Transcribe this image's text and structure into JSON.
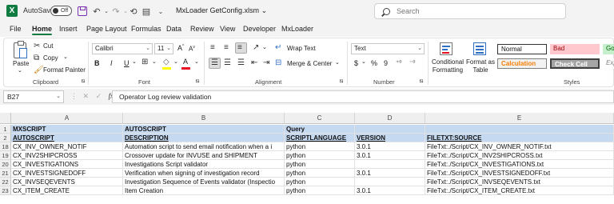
{
  "titlebar": {
    "app_icon": "X",
    "autosave_label": "AutoSave",
    "toggle_state": "Off",
    "file_title": "MxLoader GetConfig.xlsm",
    "file_title_chevron": "⌄",
    "search_placeholder": "Search"
  },
  "tabs": [
    "File",
    "Home",
    "Insert",
    "Page Layout",
    "Formulas",
    "Data",
    "Review",
    "View",
    "Developer",
    "MxLoader"
  ],
  "active_tab": "Home",
  "ribbon": {
    "clipboard": {
      "paste": "Paste",
      "cut": "Cut",
      "copy": "Copy",
      "format_painter": "Format Painter",
      "label": "Clipboard"
    },
    "font": {
      "name": "Calibri",
      "size": "11",
      "grow": "A",
      "shrink": "A",
      "bold": "B",
      "italic": "I",
      "underline": "U",
      "font_color_letter": "A",
      "label": "Font"
    },
    "alignment": {
      "wrap_text": "Wrap Text",
      "merge_center": "Merge & Center",
      "label": "Alignment"
    },
    "number": {
      "format": "Text",
      "currency": "$",
      "percent": "%",
      "comma": "9",
      "label": "Number"
    },
    "styles": {
      "conditional": "Conditional Formatting",
      "format_table": "Format as Table",
      "normal": "Normal",
      "bad": "Bad",
      "good": "Good",
      "calculation": "Calculation",
      "check_cell": "Check Cell",
      "explanatory": "Expla",
      "label": "Styles"
    }
  },
  "formula_bar": {
    "name_box": "B27",
    "fx": "fx",
    "formula": "Operator Log review validation"
  },
  "sheet": {
    "columns": [
      "A",
      "B",
      "C",
      "D",
      "E"
    ],
    "rows": [
      {
        "num": "1",
        "cells": [
          "MXSCRIPT",
          "AUTOSCRIPT",
          "Query",
          "",
          ""
        ]
      },
      {
        "num": "2",
        "cells": [
          "AUTOSCRIPT",
          "DESCRIPTION",
          "SCRIPTLANGUAGE",
          "VERSION",
          "FILETXT:SOURCE"
        ]
      },
      {
        "num": "18",
        "cells": [
          "CX_INV_OWNER_NOTIF",
          "Automation script to send email notification when a i",
          "python",
          "3.0.1",
          "FileTxt:./Script/CX_INV_OWNER_NOTIF.txt"
        ]
      },
      {
        "num": "19",
        "cells": [
          "CX_INV2SHIPCROSS",
          "Crossover update for INVUSE and SHIPMENT",
          "python",
          "3.0.1",
          "FileTxt:./Script/CX_INV2SHIPCROSS.txt"
        ]
      },
      {
        "num": "20",
        "cells": [
          "CX_INVESTIGATIONS",
          "Investigations Script validator",
          "python",
          "",
          "FileTxt:./Script/CX_INVESTIGATIONS.txt"
        ]
      },
      {
        "num": "21",
        "cells": [
          "CX_INVESTSIGNEDOFF",
          "Verification when signing of investigation record",
          "python",
          "3.0.1",
          "FileTxt:./Script/CX_INVESTSIGNEDOFF.txt"
        ]
      },
      {
        "num": "22",
        "cells": [
          "CX_INVSEQEVENTS",
          "Investigation Sequence of Events validator (Inspectio",
          "python",
          "",
          "FileTxt:./Script/CX_INVSEQEVENTS.txt"
        ]
      },
      {
        "num": "23",
        "cells": [
          "CX_ITEM_CREATE",
          "Item Creation",
          "python",
          "3.0.1",
          "FileTxt:./Script/CX_ITEM_CREATE.txt"
        ]
      }
    ]
  },
  "colors": {
    "header_fill": "#c5d9f1",
    "excel_green": "#107c41",
    "bad_fill": "#ffc7ce",
    "good_fill": "#c6efce",
    "check_cell_fill": "#a5a5a5",
    "calculation_fill": "#f2f2f2"
  }
}
